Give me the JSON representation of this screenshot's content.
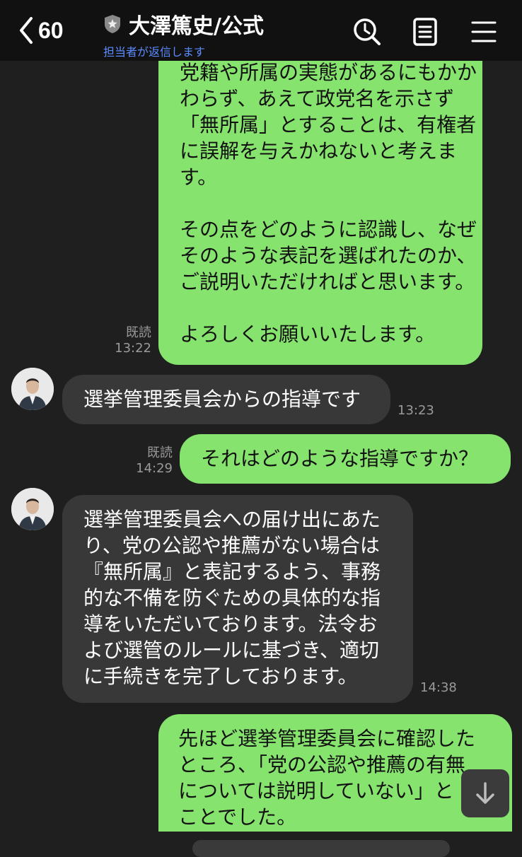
{
  "header": {
    "back_count": "60",
    "title": "大澤篤史/公式",
    "subtitle": "担当者が返信します"
  },
  "messages": [
    {
      "side": "right",
      "text": "党籍や所属の実態があるにもかか\nわらず、あえて政党名を示さず\n「無所属」とすることは、有権者\nに誤解を与えかねないと考えま\nす。\n\nその点をどのように認識し、なぜ\nそのような表記を選ばれたのか、\nご説明いただければと思います。\n\nよろしくお願いいたします。",
      "read": "既読",
      "time": "13:22"
    },
    {
      "side": "left",
      "text": "選挙管理委員会からの指導です",
      "time": "13:23"
    },
    {
      "side": "right",
      "text": "それはどのような指導ですか？",
      "read": "既読",
      "time": "14:29"
    },
    {
      "side": "left",
      "text": "選挙管理委員会への届け出にあた\nり、党の公認や推薦がない場合は\n『無所属』と表記するよう、事務\n的な不備を防ぐための具体的な指\n導をいただいております。法令お\nよび選管のルールに基づき、適切\nに手続きを完了しております。",
      "time": "14:38"
    },
    {
      "side": "right",
      "text": "先ほど選挙管理委員会に確認した\nところ、「党の公認や推薦の有無\nについては説明していない」と\nことでした。"
    }
  ],
  "colors": {
    "header_bg": "#111111",
    "bg": "#1f1f1f",
    "green_bubble": "#86e36d",
    "gray_bubble": "#383838",
    "link_blue": "#5b8cff"
  },
  "icons": [
    "chevron-left-icon",
    "shield-star-icon",
    "search-clock-icon",
    "notes-icon",
    "menu-icon",
    "arrow-down-icon"
  ]
}
